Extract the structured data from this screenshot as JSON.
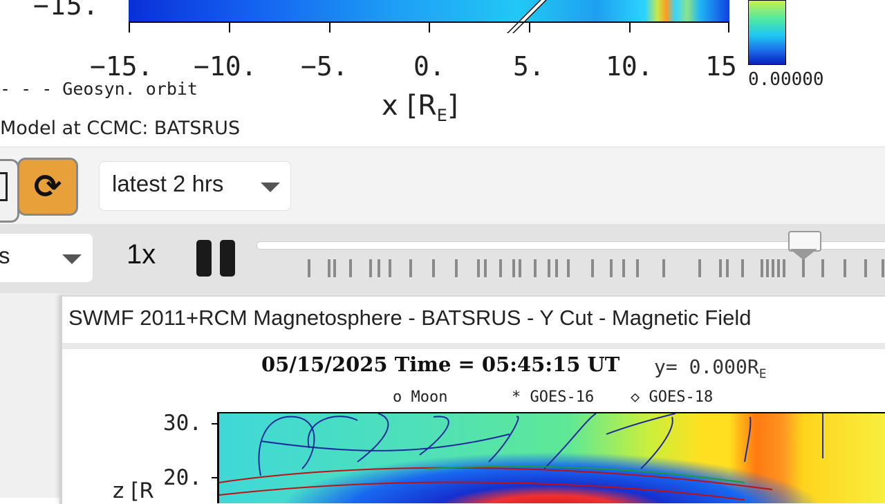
{
  "top_plot": {
    "y_tick": "−15.",
    "x_ticks": [
      "−15.",
      "−10.",
      "−5.",
      "0.",
      "5.",
      "10.",
      "15"
    ],
    "x_label_main": "x [R",
    "x_label_sub": "E",
    "x_label_end": "]",
    "colorbar_min": "0.00000",
    "orbit_legend": "- - - Geosyn. orbit",
    "model_note": "Model at CCMC: BATSRUS"
  },
  "controls": {
    "refresh_icon": "refresh-icon",
    "refresh_glyph": "⟳",
    "time_range": "latest 2 hrs"
  },
  "playback": {
    "speed_partial": "s",
    "rate": "1x",
    "pause_icon": "pause-icon",
    "slider_position_fraction": 0.86
  },
  "panel": {
    "title": "SWMF 2011+RCM Magnetosphere - BATSRUS - Y Cut - Magnetic Field",
    "plot_date_time": "05/15/2025 Time = 05:45:15 UT",
    "plot_y_main": "y= 0.000R",
    "plot_y_sub": "E",
    "legend_moon": "o Moon",
    "legend_goes16": "* GOES-16",
    "legend_goes18": "◇ GOES-18",
    "y_ticks": [
      "30.",
      "20."
    ],
    "y_label": "z [R"
  },
  "colors": {
    "refresh_button": "#e8a13a",
    "control_bg": "#f3f3f3",
    "playback_bg": "#e3e3e3"
  }
}
